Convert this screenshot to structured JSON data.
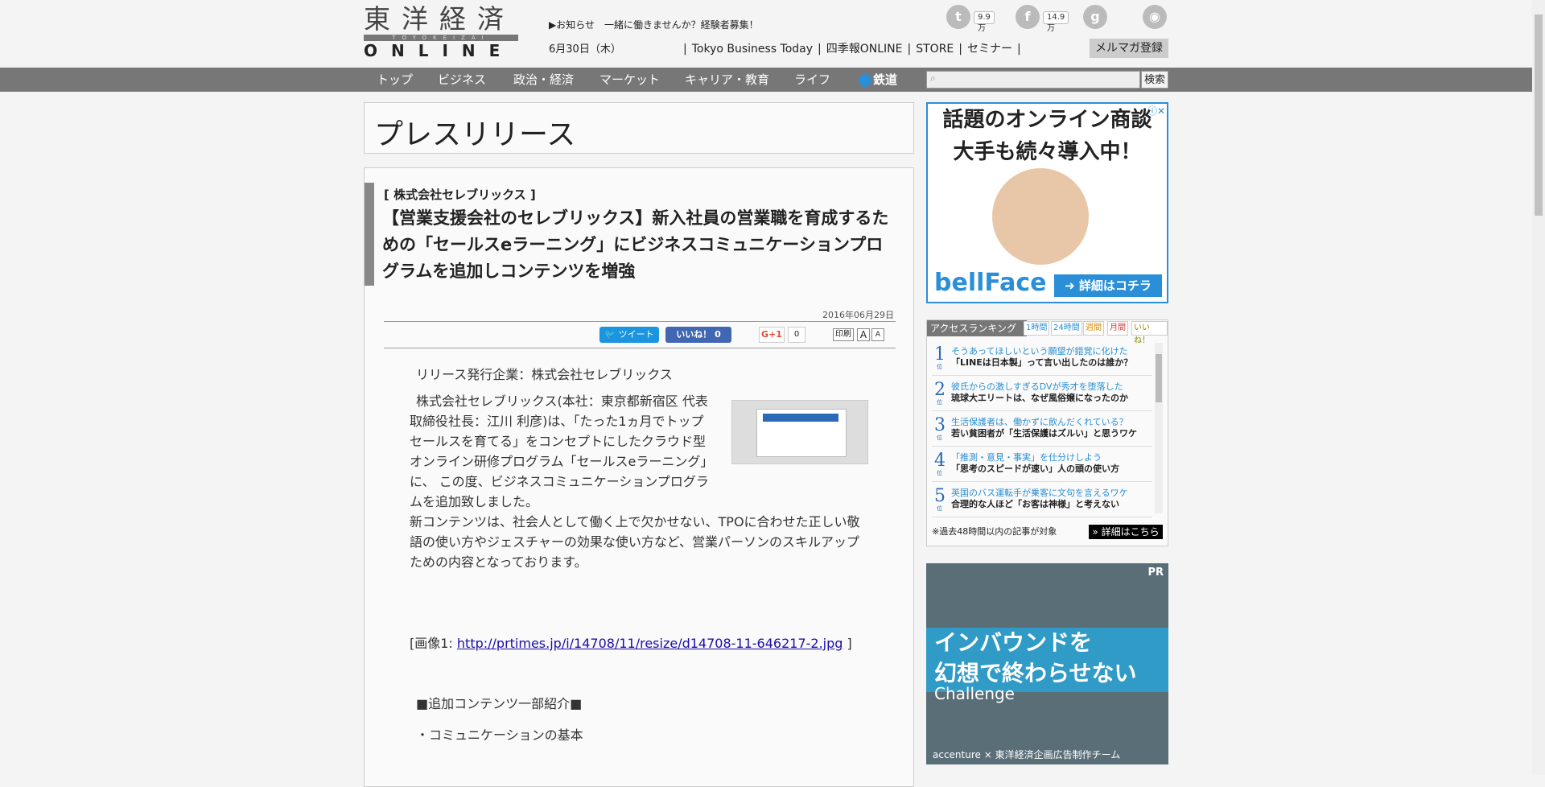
{
  "header": {
    "logo_kanji": "東洋経済",
    "logo_sub": "TOYOKEIZAI",
    "logo_online": "ONLINE",
    "notice": "▶お知らせ　一緒に働きませんか？経験者募集！",
    "date": "6月30日（木）",
    "links": [
      "Tokyo Business Today",
      "四季報ONLINE",
      "STORE",
      "セミナー"
    ],
    "twitter_count": "9.9万",
    "facebook_count": "14.9万",
    "mailmag_label": "メルマガ登録"
  },
  "nav": {
    "items": [
      "トップ",
      "ビジネス",
      "政治・経済",
      "マーケット",
      "キャリア・教育",
      "ライフ",
      "鉄道"
    ],
    "search_label": "検索"
  },
  "page_title": "プレスリリース",
  "article": {
    "company": "[ 株式会社セレブリックス ]",
    "headline": "【営業支援会社のセレブリックス】新入社員の営業職を育成するための「セールスeラーニング」にビジネスコミュニケーションプログラムを追加しコンテンツを増強",
    "date": "2016年06月29日",
    "tweet_label": "ツイート",
    "like_label": "いいね！ 0",
    "gplus_label": "G+1",
    "gplus_count": "0",
    "print_label": "印刷",
    "font_large": "A",
    "font_small": "A",
    "issuer": "リリース発行企業：株式会社セレブリックス",
    "para1": "株式会社セレブリックス(本社：東京都新宿区 代表取締役社長：江川 利彦)は、「たった1ヵ月でトップセールスを育てる」をコンセプトにしたクラウド型オンライン研修プログラム「セールスeラーニング」に、 この度、ビジネスコミュニケーションプログラムを追加致しました。",
    "para2": "新コンテンツは、社会人として働く上で欠かせない、TPOに合わせた正しい敬語の使い方やジェスチャーの効果な使い方など、営業パーソンのスキルアップための内容となっております。",
    "image_prefix": "[画像1: ",
    "image_link": "http://prtimes.jp/i/14708/11/resize/d14708-11-646217-2.jpg",
    "image_suffix": " ]",
    "section": "■追加コンテンツ一部紹介■",
    "bullet1": "・コミュニケーションの基本"
  },
  "ad1": {
    "line1": "話題のオンライン商談",
    "line2": "大手も続々導入中！",
    "brand": "bellFace",
    "cta": "➜ 詳細はコチラ"
  },
  "ranking": {
    "heading": "アクセスランキング",
    "tabs": [
      "1時間",
      "24時間",
      "週間",
      "月間",
      "いいね！"
    ],
    "items": [
      {
        "rank": "1",
        "sub": "そうあってほしいという願望が錯覚に化けた",
        "title": "「LINEは日本製」って言い出したのは誰か？"
      },
      {
        "rank": "2",
        "sub": "彼氏からの激しすぎるDVが秀才を堕落した",
        "title": "琉球大エリートは、なぜ風俗嬢になったのか"
      },
      {
        "rank": "3",
        "sub": "生活保護者は、働かずに飲んだくれている？",
        "title": "若い貧困者が「生活保護はズルい」と思うワケ"
      },
      {
        "rank": "4",
        "sub": "「推測・意見・事実」を仕分けしよう",
        "title": "「思考のスピードが速い」人の頭の使い方"
      },
      {
        "rank": "5",
        "sub": "英国のバス運転手が乗客に文句を言えるワケ",
        "title": "合理的な人ほど「お客は神様」と考えない"
      }
    ],
    "note": "※過去48時間以内の記事が対象",
    "more": "» 詳細はこちら"
  },
  "ad2": {
    "pr": "PR",
    "line1": "インバウンドを",
    "line2": "幻想で終わらせない",
    "challenge": "Challenge",
    "footer": "accenture × 東洋経済企画広告制作チーム"
  }
}
